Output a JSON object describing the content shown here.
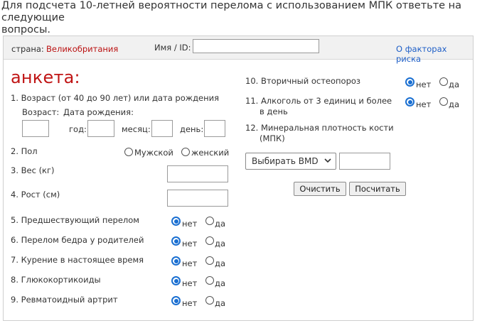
{
  "intro": {
    "line1": "Для подсчета 10-летней вероятности перелома с использованием МПК ответьте на следующие",
    "line2": "вопросы."
  },
  "topbar": {
    "country_label": "страна:",
    "country_value": "Великобритания",
    "name_label": "Имя / ID:",
    "name_value": "",
    "risk_link": "О факторах риска"
  },
  "form": {
    "title": "анкета:",
    "q1": "1. Возраст (от 40 до 90 лет) или дата рождения",
    "q1_age": "Возраст:",
    "q1_dob": "Дата рождения:",
    "q1_year": "год:",
    "q1_month": "месяц:",
    "q1_day": "день:",
    "q2": "2. Пол",
    "sex_male": "Мужской",
    "sex_female": "женский",
    "q3": "3. Вес (кг)",
    "q4": "4. Рост (см)",
    "q5": "5. Предшествующий перелом",
    "q6": "6. Перелом бедра у родителей",
    "q7": "7. Курение в настоящее время",
    "q8": "8. Глюкокортикоиды",
    "q9": "9. Ревматоидный артрит",
    "q10": "10. Вторичный остеопороз",
    "q11_line1": "11. Алкоголь от 3 единиц и более",
    "q11_line2": "в день",
    "q12_line1": "12. Минеральная плотность кости",
    "q12_line2": "(МПК)",
    "no": "нет",
    "yes": "да",
    "bmd_select": "Выбирать BMD",
    "clear_button": "Очистить",
    "calc_button": "Посчитать"
  },
  "colors": {
    "title": "#c01515",
    "country": "#bb1111",
    "link": "#1f5fc7",
    "radio_selected": "#1a6fd1"
  }
}
